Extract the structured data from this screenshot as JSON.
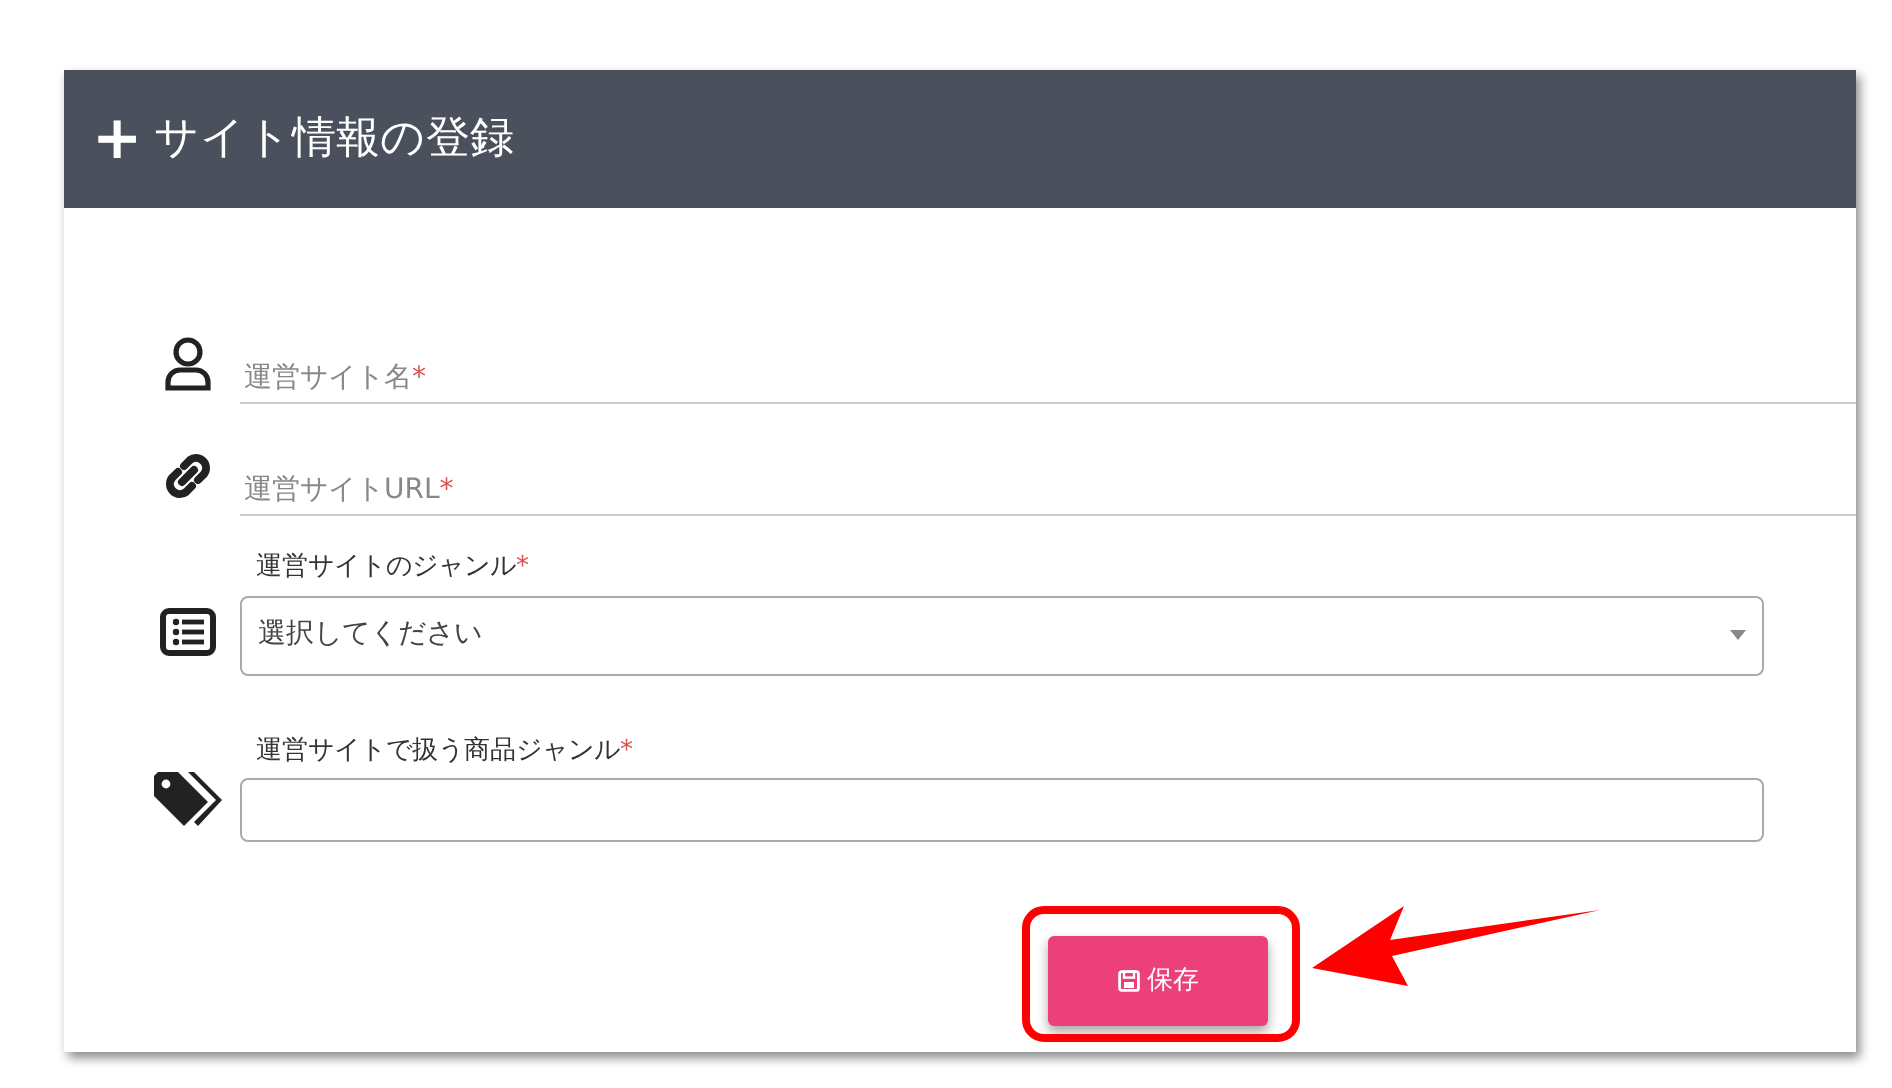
{
  "card": {
    "title_icon": "+",
    "title": "サイト情報の登録"
  },
  "fields": [
    {
      "kind": "underline",
      "label": "運営サイト名",
      "required_mark": "*"
    },
    {
      "kind": "underline",
      "label": "運営サイトURL",
      "required_mark": "*"
    },
    {
      "kind": "select",
      "label": "運営サイトのジャンル",
      "required_mark": "*",
      "value": "選択してください"
    },
    {
      "kind": "text",
      "label": "運営サイトで扱う商品ジャンル",
      "required_mark": "*"
    }
  ],
  "save_button": {
    "label": "保存"
  }
}
